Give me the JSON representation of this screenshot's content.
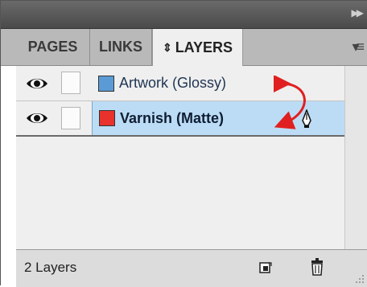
{
  "panel": {
    "tabs": [
      {
        "label": "PAGES"
      },
      {
        "label": "LINKS"
      },
      {
        "label": "LAYERS",
        "prefix": "⇕",
        "active": true
      }
    ]
  },
  "layers": [
    {
      "name": "Artwork (Glossy)",
      "color": "#5b9bd5",
      "visible": true,
      "selected": false
    },
    {
      "name": "Varnish (Matte)",
      "color": "#e8322b",
      "visible": true,
      "selected": true
    }
  ],
  "footer": {
    "count_label": "2 Layers"
  },
  "annotation": {
    "arrow_color": "#e02020"
  }
}
